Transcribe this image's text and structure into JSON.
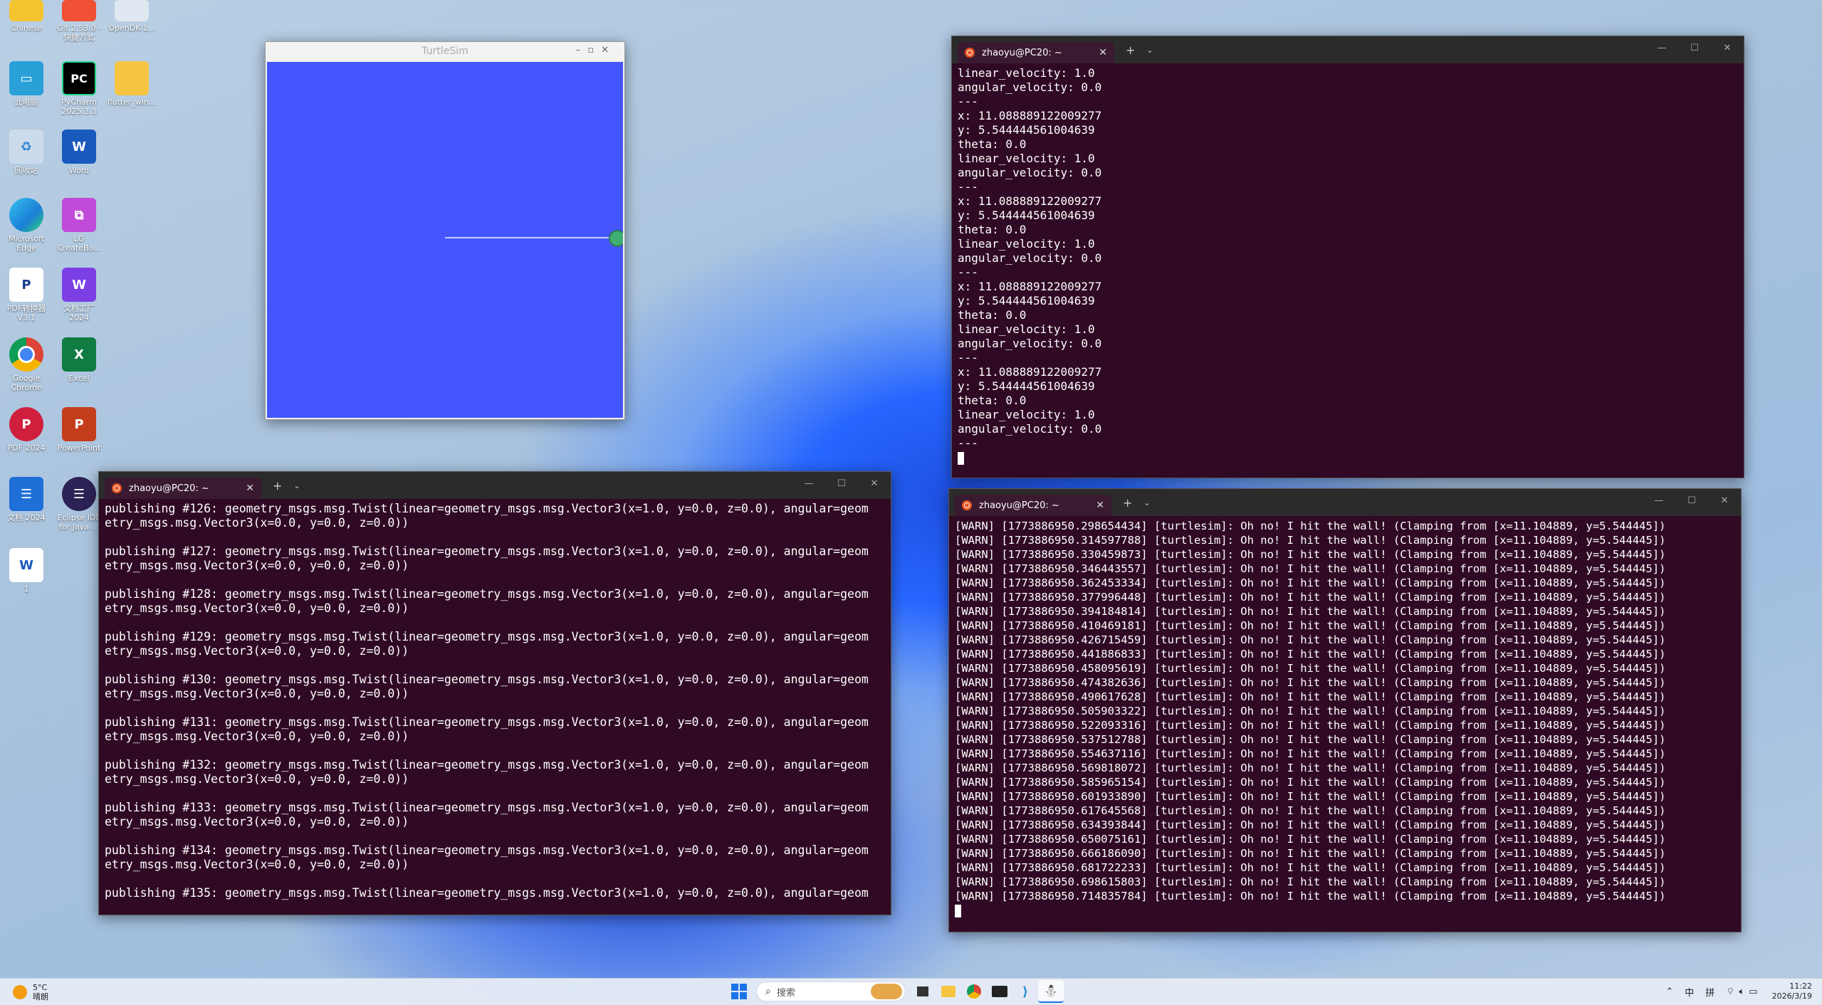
{
  "desktop": {
    "icons": [
      {
        "label": "Chinese",
        "x": 0
      },
      {
        "label": "Git 2.53.0 - 快捷方式"
      },
      {
        "label": "OpenDK-1..."
      },
      {
        "label": "此电脑"
      },
      {
        "label": "PyCharm 2025.3.3"
      },
      {
        "label": "flutter_win..."
      },
      {
        "label": "回收站"
      },
      {
        "label": "Word"
      },
      {
        "label": "Microsoft Edge"
      },
      {
        "label": "LG CreateBo..."
      },
      {
        "label": "PDF转换器 V3.1"
      },
      {
        "label": "文档工厂 2024"
      },
      {
        "label": "Google Chrome"
      },
      {
        "label": "Excel"
      },
      {
        "label": "PDF 2024"
      },
      {
        "label": "PowerPoint"
      },
      {
        "label": "文档 2024"
      },
      {
        "label": "Eclipse IDE for Java ..."
      },
      {
        "label": "1"
      }
    ]
  },
  "turtlesim": {
    "title": "TurtleSim",
    "bg_color": "#4556ff"
  },
  "term_top": {
    "tab_title": "zhaoyu@PC20: ~",
    "lines": [
      "linear_velocity: 1.0",
      "angular_velocity: 0.0",
      "---",
      "x: 11.088889122009277",
      "y: 5.544444561004639",
      "theta: 0.0",
      "linear_velocity: 1.0",
      "angular_velocity: 0.0",
      "---",
      "x: 11.088889122009277",
      "y: 5.544444561004639",
      "theta: 0.0",
      "linear_velocity: 1.0",
      "angular_velocity: 0.0",
      "---",
      "x: 11.088889122009277",
      "y: 5.544444561004639",
      "theta: 0.0",
      "linear_velocity: 1.0",
      "angular_velocity: 0.0",
      "---",
      "x: 11.088889122009277",
      "y: 5.544444561004639",
      "theta: 0.0",
      "linear_velocity: 1.0",
      "angular_velocity: 0.0",
      "---"
    ]
  },
  "term_left": {
    "tab_title": "zhaoyu@PC20: ~",
    "lines": [
      "publishing #126: geometry_msgs.msg.Twist(linear=geometry_msgs.msg.Vector3(x=1.0, y=0.0, z=0.0), angular=geom",
      "etry_msgs.msg.Vector3(x=0.0, y=0.0, z=0.0))",
      "",
      "publishing #127: geometry_msgs.msg.Twist(linear=geometry_msgs.msg.Vector3(x=1.0, y=0.0, z=0.0), angular=geom",
      "etry_msgs.msg.Vector3(x=0.0, y=0.0, z=0.0))",
      "",
      "publishing #128: geometry_msgs.msg.Twist(linear=geometry_msgs.msg.Vector3(x=1.0, y=0.0, z=0.0), angular=geom",
      "etry_msgs.msg.Vector3(x=0.0, y=0.0, z=0.0))",
      "",
      "publishing #129: geometry_msgs.msg.Twist(linear=geometry_msgs.msg.Vector3(x=1.0, y=0.0, z=0.0), angular=geom",
      "etry_msgs.msg.Vector3(x=0.0, y=0.0, z=0.0))",
      "",
      "publishing #130: geometry_msgs.msg.Twist(linear=geometry_msgs.msg.Vector3(x=1.0, y=0.0, z=0.0), angular=geom",
      "etry_msgs.msg.Vector3(x=0.0, y=0.0, z=0.0))",
      "",
      "publishing #131: geometry_msgs.msg.Twist(linear=geometry_msgs.msg.Vector3(x=1.0, y=0.0, z=0.0), angular=geom",
      "etry_msgs.msg.Vector3(x=0.0, y=0.0, z=0.0))",
      "",
      "publishing #132: geometry_msgs.msg.Twist(linear=geometry_msgs.msg.Vector3(x=1.0, y=0.0, z=0.0), angular=geom",
      "etry_msgs.msg.Vector3(x=0.0, y=0.0, z=0.0))",
      "",
      "publishing #133: geometry_msgs.msg.Twist(linear=geometry_msgs.msg.Vector3(x=1.0, y=0.0, z=0.0), angular=geom",
      "etry_msgs.msg.Vector3(x=0.0, y=0.0, z=0.0))",
      "",
      "publishing #134: geometry_msgs.msg.Twist(linear=geometry_msgs.msg.Vector3(x=1.0, y=0.0, z=0.0), angular=geom",
      "etry_msgs.msg.Vector3(x=0.0, y=0.0, z=0.0))",
      "",
      "publishing #135: geometry_msgs.msg.Twist(linear=geometry_msgs.msg.Vector3(x=1.0, y=0.0, z=0.0), angular=geom"
    ]
  },
  "term_right": {
    "tab_title": "zhaoyu@PC20: ~",
    "lines": [
      "[WARN] [1773886950.298654434] [turtlesim]: Oh no! I hit the wall! (Clamping from [x=11.104889, y=5.544445])",
      "[WARN] [1773886950.314597788] [turtlesim]: Oh no! I hit the wall! (Clamping from [x=11.104889, y=5.544445])",
      "[WARN] [1773886950.330459873] [turtlesim]: Oh no! I hit the wall! (Clamping from [x=11.104889, y=5.544445])",
      "[WARN] [1773886950.346443557] [turtlesim]: Oh no! I hit the wall! (Clamping from [x=11.104889, y=5.544445])",
      "[WARN] [1773886950.362453334] [turtlesim]: Oh no! I hit the wall! (Clamping from [x=11.104889, y=5.544445])",
      "[WARN] [1773886950.377996448] [turtlesim]: Oh no! I hit the wall! (Clamping from [x=11.104889, y=5.544445])",
      "[WARN] [1773886950.394184814] [turtlesim]: Oh no! I hit the wall! (Clamping from [x=11.104889, y=5.544445])",
      "[WARN] [1773886950.410469181] [turtlesim]: Oh no! I hit the wall! (Clamping from [x=11.104889, y=5.544445])",
      "[WARN] [1773886950.426715459] [turtlesim]: Oh no! I hit the wall! (Clamping from [x=11.104889, y=5.544445])",
      "[WARN] [1773886950.441886833] [turtlesim]: Oh no! I hit the wall! (Clamping from [x=11.104889, y=5.544445])",
      "[WARN] [1773886950.458095619] [turtlesim]: Oh no! I hit the wall! (Clamping from [x=11.104889, y=5.544445])",
      "[WARN] [1773886950.474382636] [turtlesim]: Oh no! I hit the wall! (Clamping from [x=11.104889, y=5.544445])",
      "[WARN] [1773886950.490617628] [turtlesim]: Oh no! I hit the wall! (Clamping from [x=11.104889, y=5.544445])",
      "[WARN] [1773886950.505903322] [turtlesim]: Oh no! I hit the wall! (Clamping from [x=11.104889, y=5.544445])",
      "[WARN] [1773886950.522093316] [turtlesim]: Oh no! I hit the wall! (Clamping from [x=11.104889, y=5.544445])",
      "[WARN] [1773886950.537512788] [turtlesim]: Oh no! I hit the wall! (Clamping from [x=11.104889, y=5.544445])",
      "[WARN] [1773886950.554637116] [turtlesim]: Oh no! I hit the wall! (Clamping from [x=11.104889, y=5.544445])",
      "[WARN] [1773886950.569818072] [turtlesim]: Oh no! I hit the wall! (Clamping from [x=11.104889, y=5.544445])",
      "[WARN] [1773886950.585965154] [turtlesim]: Oh no! I hit the wall! (Clamping from [x=11.104889, y=5.544445])",
      "[WARN] [1773886950.601933890] [turtlesim]: Oh no! I hit the wall! (Clamping from [x=11.104889, y=5.544445])",
      "[WARN] [1773886950.617645568] [turtlesim]: Oh no! I hit the wall! (Clamping from [x=11.104889, y=5.544445])",
      "[WARN] [1773886950.634393844] [turtlesim]: Oh no! I hit the wall! (Clamping from [x=11.104889, y=5.544445])",
      "[WARN] [1773886950.650075161] [turtlesim]: Oh no! I hit the wall! (Clamping from [x=11.104889, y=5.544445])",
      "[WARN] [1773886950.666186090] [turtlesim]: Oh no! I hit the wall! (Clamping from [x=11.104889, y=5.544445])",
      "[WARN] [1773886950.681722233] [turtlesim]: Oh no! I hit the wall! (Clamping from [x=11.104889, y=5.544445])",
      "[WARN] [1773886950.698615803] [turtlesim]: Oh no! I hit the wall! (Clamping from [x=11.104889, y=5.544445])",
      "[WARN] [1773886950.714835784] [turtlesim]: Oh no! I hit the wall! (Clamping from [x=11.104889, y=5.544445])"
    ]
  },
  "taskbar": {
    "weather_temp": "5°C",
    "weather_desc": "晴朗",
    "search_placeholder": "搜索",
    "tray_ime_1": "中",
    "tray_ime_2": "拼",
    "time": "11:22",
    "date": "2026/3/19"
  }
}
